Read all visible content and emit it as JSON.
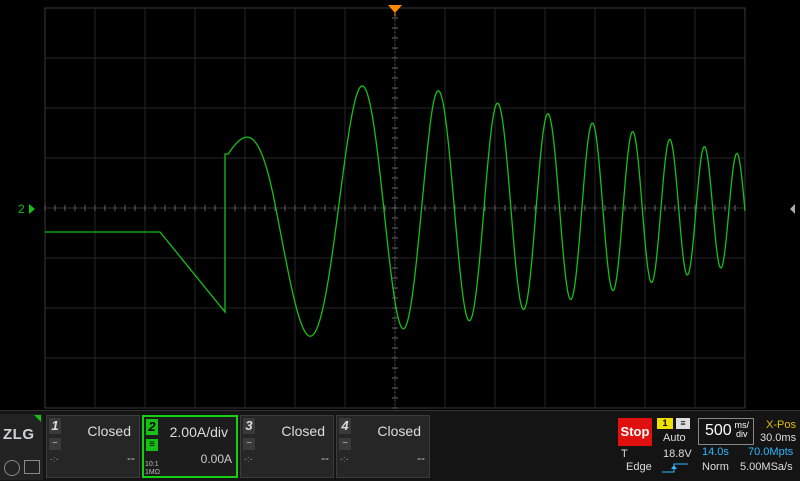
{
  "logo": "ZLG",
  "scope": {
    "divisions": {
      "x": 14,
      "y": 8
    },
    "trace_color": "#16c016",
    "trigger_marker_color": "#ff8a00",
    "ch2_marker": "2"
  },
  "channels": [
    {
      "number": "1",
      "state": "Closed",
      "value": "--",
      "coupling": "-:-",
      "probe": ""
    },
    {
      "number": "2",
      "state": "2.00A/div",
      "value": "0.00A",
      "coupling": "",
      "probe": "10:1\n1MΩ"
    },
    {
      "number": "3",
      "state": "Closed",
      "value": "--",
      "coupling": "-:-",
      "probe": ""
    },
    {
      "number": "4",
      "state": "Closed",
      "value": "--",
      "coupling": "-:-",
      "probe": ""
    }
  ],
  "run": {
    "label": "Stop",
    "color": "#e01010"
  },
  "trigger": {
    "source": "1",
    "mode": "Auto",
    "level_label": "T",
    "level": "18.8V",
    "type": "Edge",
    "slope_icon": "rising-edge-icon"
  },
  "timebase": {
    "value": "500",
    "unit_top": "ms/",
    "unit_bottom": "div",
    "time": "14.0s",
    "points": "70.0Mpts",
    "acq_mode": "Norm",
    "sample_rate": "5.00MSa/s"
  },
  "xpos": {
    "label": "X-Pos",
    "value": "30.0ms"
  }
}
